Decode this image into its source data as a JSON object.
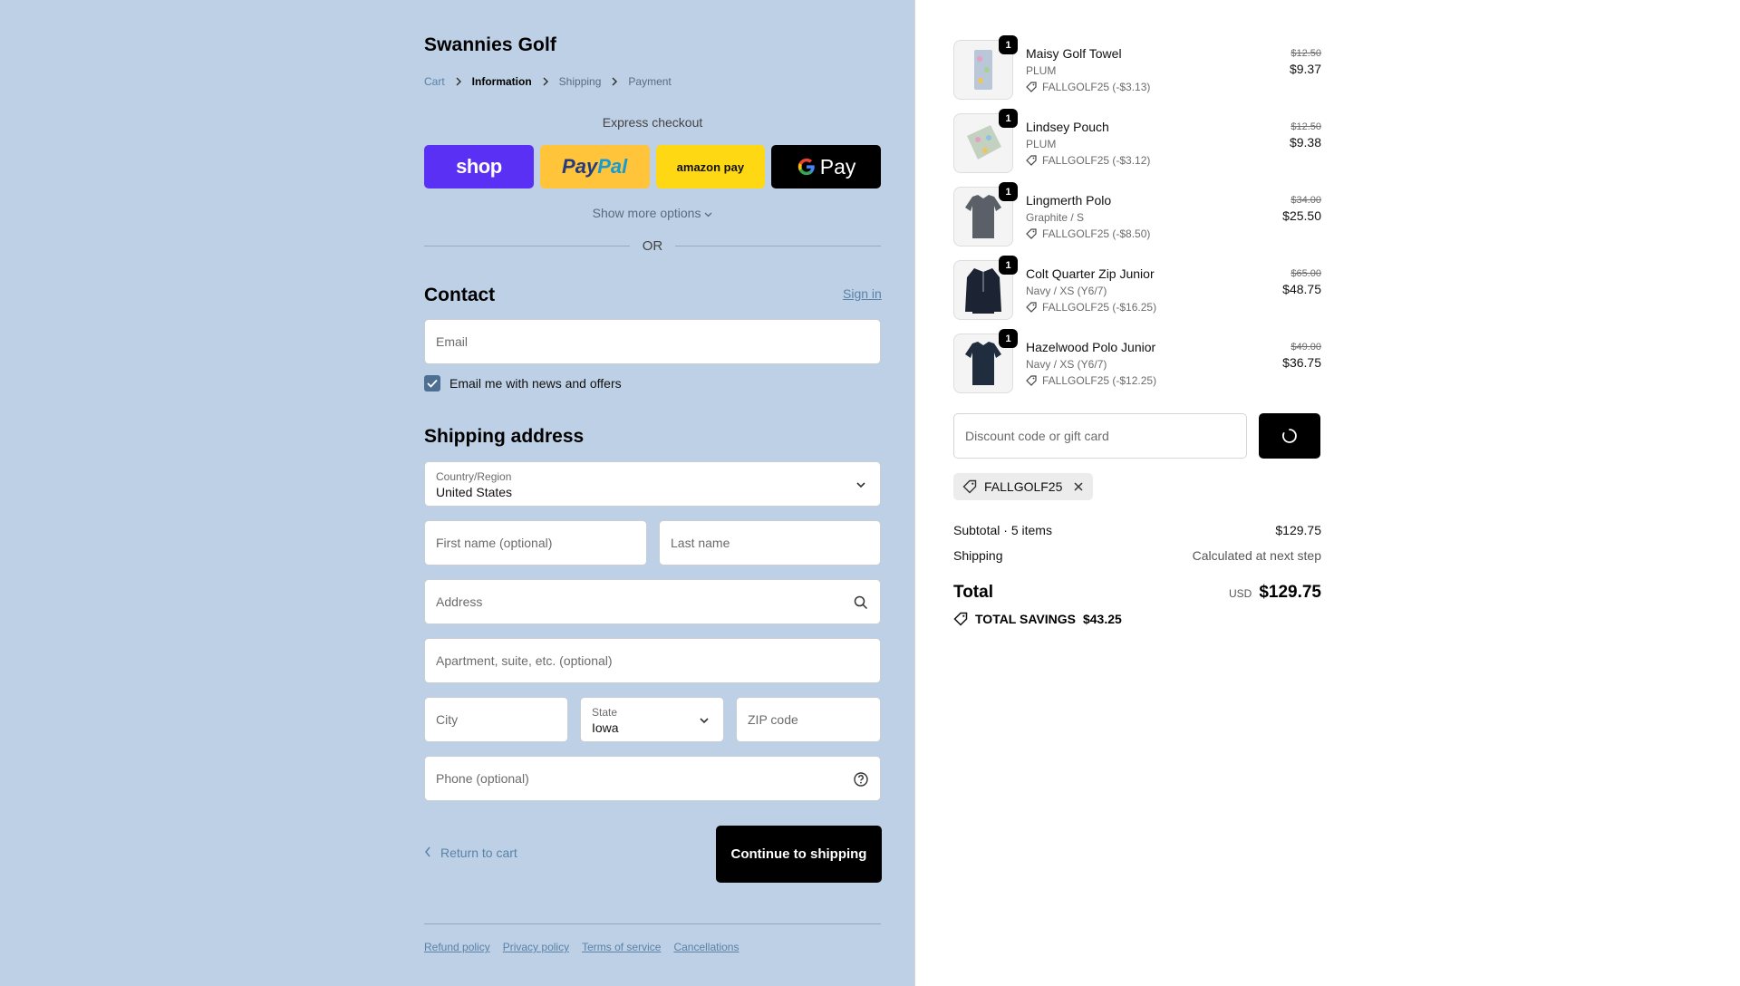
{
  "store": {
    "name": "Swannies Golf"
  },
  "breadcrumbs": [
    {
      "label": "Cart"
    },
    {
      "label": "Information"
    },
    {
      "label": "Shipping"
    },
    {
      "label": "Payment"
    }
  ],
  "express": {
    "title": "Express checkout",
    "buttons": {
      "shop": "shop",
      "paypal_a": "Pay",
      "paypal_b": "Pal",
      "amazon": "amazon pay",
      "gpay": "Pay"
    },
    "show_more": "Show more options",
    "or": "OR"
  },
  "contact": {
    "heading": "Contact",
    "sign_in": "Sign in",
    "email_placeholder": "Email",
    "news_checkbox_label": "Email me with news and offers",
    "news_checked": true
  },
  "shipping": {
    "heading": "Shipping address",
    "country_label": "Country/Region",
    "country_value": "United States",
    "first_name_placeholder": "First name (optional)",
    "last_name_placeholder": "Last name",
    "address_placeholder": "Address",
    "apartment_placeholder": "Apartment, suite, etc. (optional)",
    "city_placeholder": "City",
    "state_label": "State",
    "state_value": "Iowa",
    "zip_placeholder": "ZIP code",
    "phone_placeholder": "Phone (optional)"
  },
  "actions": {
    "return": "Return to cart",
    "continue": "Continue to shipping"
  },
  "footer": {
    "links": [
      "Refund policy",
      "Privacy policy",
      "Terms of service",
      "Cancellations"
    ]
  },
  "order": {
    "items": [
      {
        "name": "Maisy Golf Towel",
        "variant": "PLUM",
        "discount": "FALLGOLF25 (-$3.13)",
        "old_price": "$12.50",
        "price": "$9.37",
        "qty": "1",
        "color": "#b9c7d8"
      },
      {
        "name": "Lindsey Pouch",
        "variant": "PLUM",
        "discount": "FALLGOLF25 (-$3.12)",
        "old_price": "$12.50",
        "price": "$9.38",
        "qty": "1",
        "color": "#c3d2c0"
      },
      {
        "name": "Lingmerth Polo",
        "variant": "Graphite / S",
        "discount": "FALLGOLF25 (-$8.50)",
        "old_price": "$34.00",
        "price": "$25.50",
        "qty": "1",
        "color": "#5a5f68"
      },
      {
        "name": "Colt Quarter Zip Junior",
        "variant": "Navy / XS (Y6/7)",
        "discount": "FALLGOLF25 (-$16.25)",
        "old_price": "$65.00",
        "price": "$48.75",
        "qty": "1",
        "color": "#1c2433"
      },
      {
        "name": "Hazelwood Polo Junior",
        "variant": "Navy / XS (Y6/7)",
        "discount": "FALLGOLF25 (-$12.25)",
        "old_price": "$49.00",
        "price": "$36.75",
        "qty": "1",
        "color": "#1f2d3f"
      }
    ],
    "discount_placeholder": "Discount code or gift card",
    "applied_code": "FALLGOLF25",
    "subtotal_label": "Subtotal · 5 items",
    "subtotal_value": "$129.75",
    "shipping_label": "Shipping",
    "shipping_value": "Calculated at next step",
    "total_label": "Total",
    "total_currency": "USD",
    "total_value": "$129.75",
    "savings_label": "TOTAL SAVINGS",
    "savings_value": "$43.25"
  }
}
